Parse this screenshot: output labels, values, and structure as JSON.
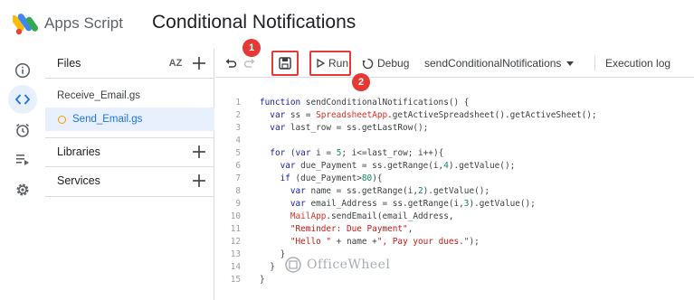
{
  "header": {
    "app_name": "Apps Script",
    "project_title": "Conditional Notifications"
  },
  "rail": {
    "items": [
      {
        "icon": "info-icon"
      },
      {
        "icon": "code-icon",
        "active": true
      },
      {
        "icon": "alarm-icon"
      },
      {
        "icon": "executions-icon"
      },
      {
        "icon": "gear-icon"
      }
    ]
  },
  "files_panel": {
    "files_title": "Files",
    "sort_label": "AZ",
    "files": [
      {
        "name": "Receive_Email.gs",
        "selected": false
      },
      {
        "name": "Send_Email.gs",
        "selected": true
      }
    ],
    "libraries_title": "Libraries",
    "services_title": "Services"
  },
  "toolbar": {
    "run_label": "Run",
    "debug_label": "Debug",
    "function_select": "sendConditionalNotifications",
    "execution_log_label": "Execution log",
    "badge_1": "1",
    "badge_2": "2",
    "highlight_color": "#e53935"
  },
  "editor": {
    "line_numbers": [
      "1",
      "2",
      "3",
      "4",
      "5",
      "6",
      "7",
      "8",
      "9",
      "10",
      "11",
      "12",
      "13",
      "14",
      "15"
    ]
  },
  "watermark": {
    "text": "OfficeWheel"
  }
}
